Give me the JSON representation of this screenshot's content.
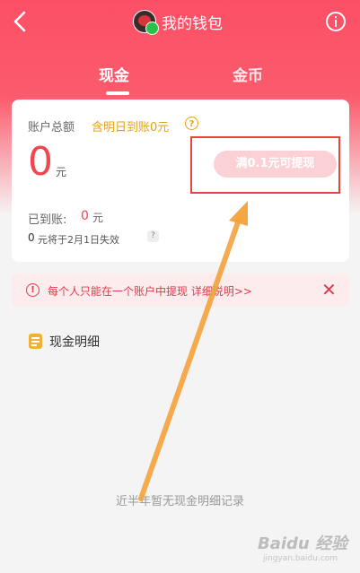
{
  "header": {
    "title": "我的钱包"
  },
  "tabs": [
    {
      "label": "现金"
    },
    {
      "label": "金币"
    }
  ],
  "card": {
    "total_label": "账户总额",
    "pending_label": "含明日到账0元",
    "help_glyph": "?",
    "amount": "0",
    "unit": "元",
    "withdraw_button": "满0.1元可提现",
    "arrived_label": "已到账:",
    "arrived_amount": "0",
    "arrived_unit": "元",
    "expire_amount": "0",
    "expire_text": "元将于2月1日失效",
    "expire_help": "?"
  },
  "notice": {
    "text": "每个人只能在一个账户中提现 详细说明>>",
    "close": "✕",
    "icon_glyph": "!"
  },
  "detail": {
    "label": "现金明细"
  },
  "empty_state": {
    "text": "近半年暂无现金明细记录"
  },
  "watermark": {
    "brand": "Baidu 经验",
    "sub": "jingyan.baidu.com"
  },
  "colors": {
    "header_red": "#fc4f66",
    "accent_red": "#f2454f",
    "gold": "#e4a11a",
    "annotation_arrow": "#f4a23c",
    "annotation_box": "#e8453f"
  }
}
